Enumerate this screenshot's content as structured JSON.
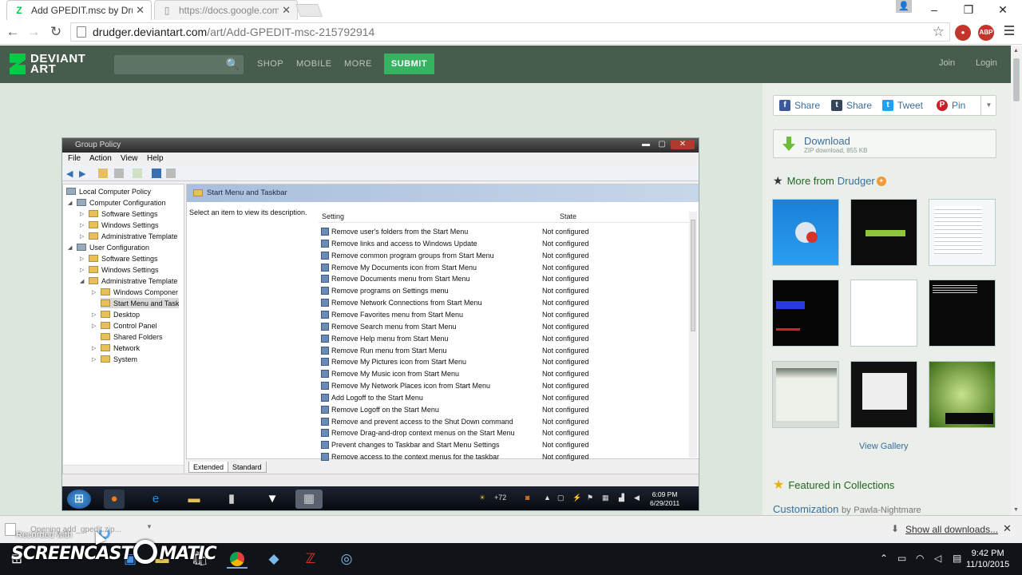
{
  "browser": {
    "tabs": [
      {
        "title": "Add GPEDIT.msc by Drudg",
        "active": true,
        "favicon": "deviantart-icon"
      },
      {
        "title": "https://docs.google.com/",
        "active": false,
        "favicon": "page-icon"
      }
    ],
    "url_host": "drudger.deviantart.com",
    "url_path": "/art/Add-GPEDIT-msc-215792914",
    "extension_abp": "ABP"
  },
  "da": {
    "logo_line1": "DEVIANT",
    "logo_line2": "ART",
    "nav": [
      "SHOP",
      "MOBILE",
      "MORE"
    ],
    "submit": "SUBMIT",
    "join": "Join",
    "login": "Login"
  },
  "gp": {
    "window_title": "Group Policy",
    "menu": [
      "File",
      "Action",
      "View",
      "Help"
    ],
    "tree": [
      {
        "label": "Local Computer Policy",
        "level": 0
      },
      {
        "label": "Computer Configuration",
        "level": 1
      },
      {
        "label": "Software Settings",
        "level": 2
      },
      {
        "label": "Windows Settings",
        "level": 2
      },
      {
        "label": "Administrative Template",
        "level": 2
      },
      {
        "label": "User Configuration",
        "level": 1
      },
      {
        "label": "Software Settings",
        "level": 2
      },
      {
        "label": "Windows Settings",
        "level": 2
      },
      {
        "label": "Administrative Template",
        "level": 2
      },
      {
        "label": "Windows Componer",
        "level": 3
      },
      {
        "label": "Start Menu and Task",
        "level": 3
      },
      {
        "label": "Desktop",
        "level": 3
      },
      {
        "label": "Control Panel",
        "level": 3
      },
      {
        "label": "Shared Folders",
        "level": 3
      },
      {
        "label": "Network",
        "level": 3
      },
      {
        "label": "System",
        "level": 3
      }
    ],
    "header": "Start Menu and Taskbar",
    "description": "Select an item to view its description.",
    "col_setting": "Setting",
    "col_state": "State",
    "rows": [
      "Remove user's folders from the Start Menu",
      "Remove links and access to Windows Update",
      "Remove common program groups from Start Menu",
      "Remove My Documents icon from Start Menu",
      "Remove Documents menu from Start Menu",
      "Remove programs on Settings menu",
      "Remove Network Connections from Start Menu",
      "Remove Favorites menu from Start Menu",
      "Remove Search menu from Start Menu",
      "Remove Help menu from Start Menu",
      "Remove Run menu from Start Menu",
      "Remove My Pictures icon from Start Menu",
      "Remove My Music icon from Start Menu",
      "Remove My Network Places icon from Start Menu",
      "Add Logoff to the Start Menu",
      "Remove Logoff on the Start Menu",
      "Remove and prevent access to the Shut Down command",
      "Remove Drag-and-drop context menus on the Start Menu",
      "Prevent changes to Taskbar and Start Menu Settings",
      "Remove access to the context menus for the taskbar"
    ],
    "state_value": "Not configured",
    "tab_extended": "Extended",
    "tab_standard": "Standard",
    "tray_temp": "+72",
    "clock_time": "6:09 PM",
    "clock_date": "6/29/2011"
  },
  "sidebar": {
    "share": [
      {
        "label": "Share",
        "icon": "facebook-icon",
        "color": "#3b5998",
        "glyph": "f"
      },
      {
        "label": "Share",
        "icon": "tumblr-icon",
        "color": "#35465c",
        "glyph": "t"
      },
      {
        "label": "Tweet",
        "icon": "twitter-icon",
        "color": "#1da1f2",
        "glyph": "t"
      },
      {
        "label": "Pin",
        "icon": "pinterest-icon",
        "color": "#cb2027",
        "glyph": "P"
      }
    ],
    "download_label": "Download",
    "download_sub": "ZIP download, 855 KB",
    "more_from": "More from",
    "author": "Drudger",
    "view_gallery": "View Gallery",
    "featured": "Featured in Collections",
    "collection_title": "Customization",
    "collection_by": "by",
    "collection_author": "Pawla-Nightmare"
  },
  "shelf": {
    "download_name": "Opening add_gpedit.zip...",
    "recorded_with": "Recorded with",
    "show_all": "Show all downloads..."
  },
  "taskbar": {
    "brand": "SCREENCAST",
    "brand_suffix": "MATIC",
    "time": "9:42 PM",
    "date": "11/10/2015"
  }
}
